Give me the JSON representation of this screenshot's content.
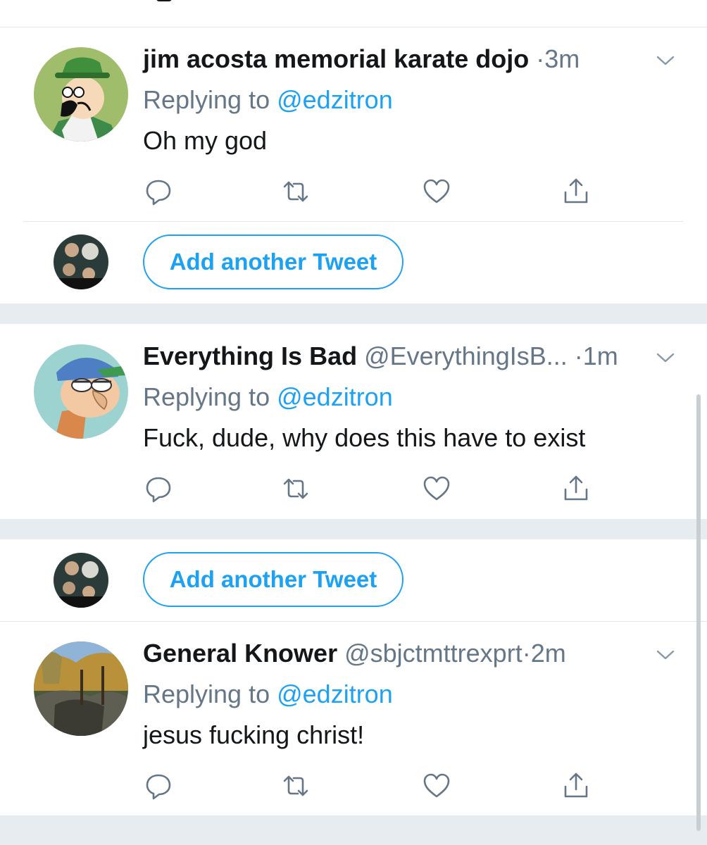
{
  "tweets": [
    {
      "name": "jim acosta memorial karate dojo",
      "handle": "",
      "separator": "·",
      "time": "3m",
      "replying_prefix": "Replying to ",
      "replying_to": "@edzitron",
      "text": "Oh my god",
      "avatar_icon": "cartoon-man-green-hat-avatar"
    },
    {
      "name": "Everything Is Bad",
      "handle": "@EverythingIsB...",
      "separator": "·",
      "time": "1m",
      "replying_prefix": "Replying to ",
      "replying_to": "@edzitron",
      "text": "Fuck, dude, why does this have to exist",
      "avatar_icon": "cartoon-character-cap-avatar"
    },
    {
      "name": "General Knower",
      "handle": "@sbjctmttrexprt",
      "separator": "·",
      "time": "2m",
      "replying_prefix": "Replying to ",
      "replying_to": "@edzitron",
      "text": "jesus fucking christ!",
      "avatar_icon": "forest-rock-photo-avatar"
    }
  ],
  "compose": {
    "add_another_label": "Add another Tweet",
    "user_avatar_icon": "user-photo-collage-avatar"
  },
  "icons": {
    "reply": "reply-icon",
    "retweet": "retweet-icon",
    "like": "heart-icon",
    "share": "share-icon",
    "more": "chevron-down-icon"
  },
  "colors": {
    "accent": "#1da1f2",
    "secondary_text": "#657786",
    "primary_text": "#14171a",
    "divider": "#e1e8ed",
    "gap": "#e6ecf0"
  }
}
